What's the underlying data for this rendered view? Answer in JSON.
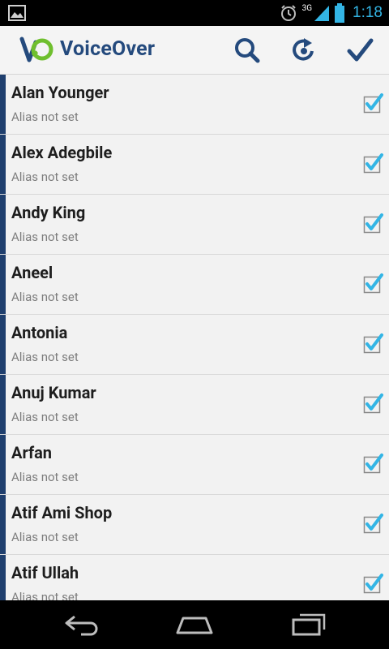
{
  "status_bar": {
    "network": "3G",
    "time": "1:18"
  },
  "app": {
    "title": "VoiceOver",
    "accent_color": "#244a7d",
    "logo_green": "#6fbf2e"
  },
  "toolbar": {
    "actions": [
      "search-icon",
      "refresh-icon",
      "confirm-check-icon"
    ]
  },
  "contacts": [
    {
      "name": "Alan Younger",
      "alias": "Alias not set",
      "checked": true
    },
    {
      "name": "Alex Adegbile",
      "alias": "Alias not set",
      "checked": true
    },
    {
      "name": "Andy King",
      "alias": "Alias not set",
      "checked": true
    },
    {
      "name": "Aneel",
      "alias": "Alias not set",
      "checked": true
    },
    {
      "name": "Antonia",
      "alias": "Alias not set",
      "checked": true
    },
    {
      "name": "Anuj Kumar",
      "alias": "Alias not set",
      "checked": true
    },
    {
      "name": "Arfan",
      "alias": "Alias not set",
      "checked": true
    },
    {
      "name": "Atif Ami Shop",
      "alias": "Alias not set",
      "checked": true
    },
    {
      "name": "Atif Ullah",
      "alias": "Alias not set",
      "checked": true
    }
  ],
  "nav_bar": {
    "buttons": [
      "back-icon",
      "home-icon",
      "recent-apps-icon"
    ]
  }
}
